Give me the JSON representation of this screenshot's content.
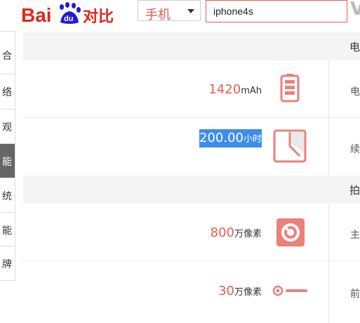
{
  "header": {
    "logo_text": "Bai du 对比",
    "category_select": {
      "value": "手机"
    },
    "search": {
      "value": "iphone4s"
    },
    "vs_text": "V"
  },
  "sidebar": {
    "items": [
      {
        "label": "合"
      },
      {
        "label": "络"
      },
      {
        "label": "观"
      },
      {
        "label": "能",
        "active": true
      },
      {
        "label": "统"
      },
      {
        "label": "能"
      },
      {
        "label": "牌"
      }
    ]
  },
  "main": {
    "sections": [
      {
        "head_char": "电",
        "rows": [
          {
            "value": "1420",
            "unit": "mAh",
            "icon": "battery-icon",
            "right_char": "电"
          },
          {
            "value": "200.00",
            "unit": "小时",
            "icon": "clock-icon",
            "right_char": "续",
            "selected": true
          }
        ]
      },
      {
        "head_char": "拍",
        "rows": [
          {
            "value": "800",
            "unit": "万像素",
            "icon": "camera-icon",
            "right_char": "主"
          },
          {
            "value": "30",
            "unit": "万像素",
            "icon": "front-camera-icon",
            "right_char": "前"
          }
        ]
      }
    ]
  },
  "colors": {
    "accent": "#e35d52",
    "selection": "#3c8ee8",
    "section_bg": "#f4f4f4"
  }
}
